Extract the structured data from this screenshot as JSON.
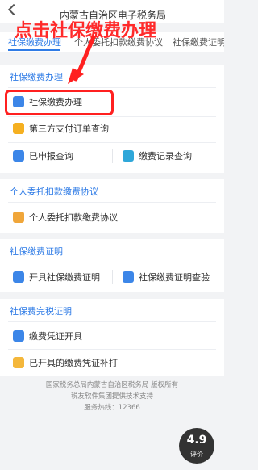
{
  "header": {
    "title": "内蒙古自治区电子税务局"
  },
  "tabs": [
    {
      "label": "社保缴费办理"
    },
    {
      "label": "个人委托扣款缴费协议"
    },
    {
      "label": "社保缴费证明"
    }
  ],
  "sections": {
    "s1": {
      "title": "社保缴费办理",
      "items": [
        {
          "label": "社保缴费办理",
          "icon": "social-security-icon"
        },
        {
          "label": "第三方支付订单查询",
          "icon": "shield-icon"
        },
        {
          "label": "已申报查询",
          "icon": "search-icon"
        },
        {
          "label": "缴费记录查询",
          "icon": "document-icon"
        }
      ]
    },
    "s2": {
      "title": "个人委托扣款缴费协议",
      "items": [
        {
          "label": "个人委托扣款缴费协议",
          "icon": "agreement-icon"
        }
      ]
    },
    "s3": {
      "title": "社保缴费证明",
      "items": [
        {
          "label": "开具社保缴费证明",
          "icon": "certificate-icon"
        },
        {
          "label": "社保缴费证明查验",
          "icon": "verify-icon"
        }
      ]
    },
    "s4": {
      "title": "社保费完税证明",
      "items": [
        {
          "label": "缴费凭证开具",
          "icon": "voucher-icon"
        },
        {
          "label": "已开具的缴费凭证补打",
          "icon": "reprint-icon"
        }
      ]
    }
  },
  "footer": {
    "line1": "国家税务总局内蒙古自治区税务局 版权所有",
    "line2": "税友软件集团提供技术支持",
    "line3": "服务热线：12366"
  },
  "rating": {
    "score": "4.9",
    "label": "评价"
  },
  "annotation": {
    "text": "点击社保缴费办理",
    "color": "#ff2a2a"
  },
  "colors": {
    "accent": "#2e7be6",
    "annotation_red": "#ff2020"
  }
}
